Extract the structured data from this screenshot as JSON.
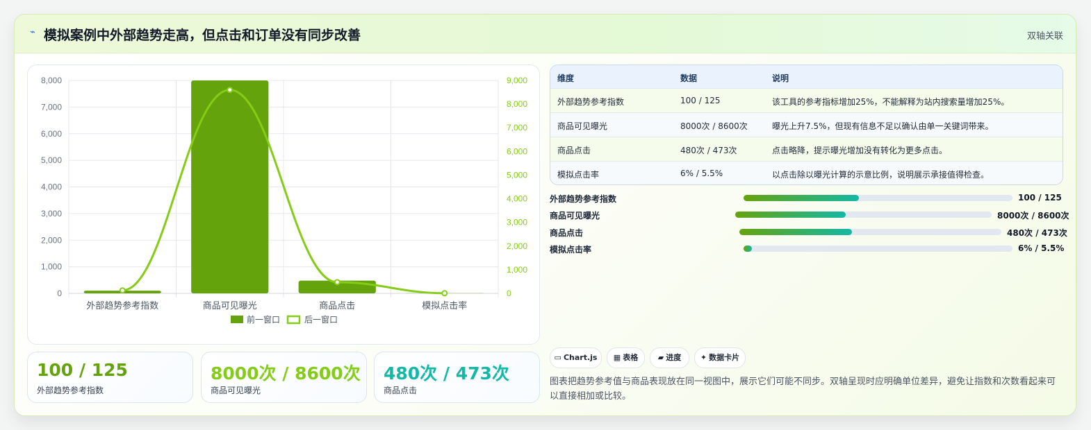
{
  "header": {
    "icon": "⌁",
    "title": "模拟案例中外部趋势走高，但点击和订单没有同步改善",
    "tag": "双轴关联"
  },
  "chart_data": {
    "type": "bar",
    "categories": [
      "外部趋势参考指数",
      "商品可见曝光",
      "商品点击",
      "模拟点击率"
    ],
    "series": [
      {
        "name": "前一窗口",
        "type": "bar",
        "axis": "left",
        "values": [
          100,
          8000,
          480,
          6
        ]
      },
      {
        "name": "后一窗口",
        "type": "line",
        "axis": "right",
        "values": [
          125,
          8600,
          473,
          5.5
        ]
      }
    ],
    "y_left": {
      "min": 0,
      "max": 8000,
      "ticks": [
        "0",
        "1,000",
        "2,000",
        "3,000",
        "4,000",
        "5,000",
        "6,000",
        "7,000",
        "8,000"
      ]
    },
    "y_right": {
      "min": 0,
      "max": 9000,
      "ticks": [
        "0",
        "1,000",
        "2,000",
        "3,000",
        "4,000",
        "5,000",
        "6,000",
        "7,000",
        "8,000",
        "9,000"
      ]
    },
    "grid": true,
    "legend_position": "bottom",
    "colors": {
      "bar": "#65a30d",
      "line": "#84cc16",
      "axis_left": "#6b7280",
      "axis_right": "#84cc16"
    }
  },
  "kpis": [
    {
      "value": "100 / 125",
      "label": "外部趋势参考指数",
      "color": "#65a30d"
    },
    {
      "value": "8000次 / 8600次",
      "label": "商品可见曝光",
      "color": "#84cc16"
    },
    {
      "value": "480次 / 473次",
      "label": "商品点击",
      "color": "#14b8a6"
    }
  ],
  "table": {
    "headers": [
      "维度",
      "数据",
      "说明"
    ],
    "rows": [
      [
        "外部趋势参考指数",
        "100 / 125",
        "该工具的参考指标增加25%，不能解释为站内搜索量增加25%。"
      ],
      [
        "商品可见曝光",
        "8000次 / 8600次",
        "曝光上升7.5%，但现有信息不足以确认由单一关键词带来。"
      ],
      [
        "商品点击",
        "480次 / 473次",
        "点击略降，提示曝光增加没有转化为更多点击。"
      ],
      [
        "模拟点击率",
        "6% / 5.5%",
        "以点击除以曝光计算的示意比例，说明展示承接值得检查。"
      ]
    ],
    "row_colors": [
      "#f6fcec",
      "#f7fafc",
      "#f6fcec",
      "#f7fafc"
    ]
  },
  "progress": [
    {
      "label": "外部趋势参考指数",
      "value": "100 / 125",
      "fraction": 0.43
    },
    {
      "label": "商品可见曝光",
      "value": "8000次 / 8600次",
      "fraction": 0.43
    },
    {
      "label": "商品点击",
      "value": "480次 / 473次",
      "fraction": 0.43
    },
    {
      "label": "模拟点击率",
      "value": "6% / 5.5%",
      "fraction": 0.03
    }
  ],
  "chips": [
    {
      "icon": "▭",
      "label": "Chart.js"
    },
    {
      "icon": "▦",
      "label": "表格"
    },
    {
      "icon": "▰",
      "label": "进度"
    },
    {
      "icon": "✦",
      "label": "数据卡片"
    }
  ],
  "description": "图表把趋势参考值与商品表现放在同一视图中，展示它们可能不同步。双轴呈现时应明确单位差异，避免让指数和次数看起来可以直接相加或比较。"
}
